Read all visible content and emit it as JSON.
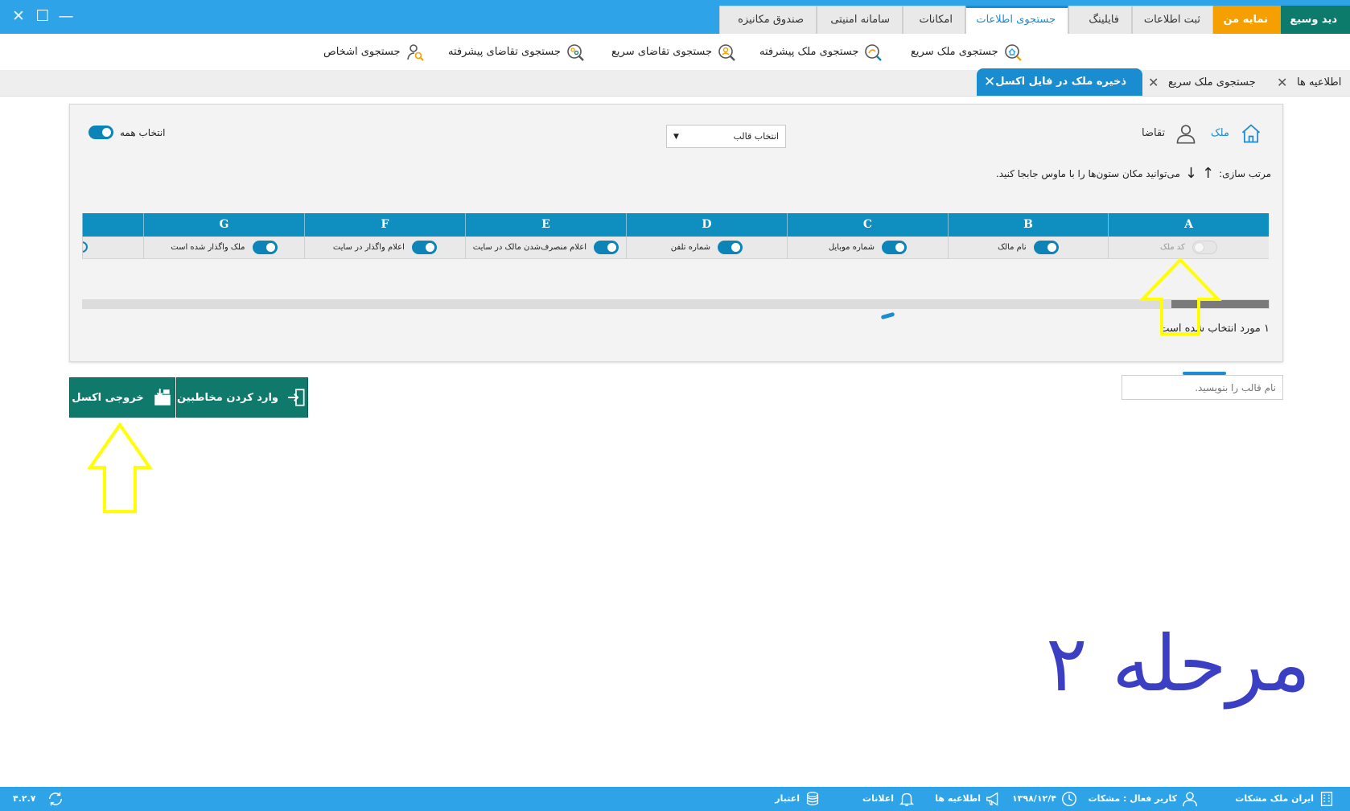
{
  "window": {
    "close": "✕",
    "maximize": "☐",
    "minimize": "—"
  },
  "main_tabs": [
    {
      "label": "دید وسیع"
    },
    {
      "label": "نمایه من"
    },
    {
      "label": "ثبت اطلاعات"
    },
    {
      "label": "فایلینگ"
    },
    {
      "label": "جستجوی اطلاعات"
    },
    {
      "label": "امکانات"
    },
    {
      "label": "سامانه امنیتی"
    },
    {
      "label": "صندوق مکانیزه"
    }
  ],
  "sub_toolbar": [
    {
      "label": "جستجوی ملک سریع",
      "icon": "home-search-icon"
    },
    {
      "label": "جستجوی ملک پیشرفته",
      "icon": "advanced-search-icon"
    },
    {
      "label": "جستجوی تقاضای سریع",
      "icon": "person-search-icon"
    },
    {
      "label": "جستجوی تقاضای پیشرفته",
      "icon": "advanced-person-search-icon"
    },
    {
      "label": "جستجوی اشخاص",
      "icon": "people-search-icon"
    }
  ],
  "doc_tabs": [
    {
      "label": "اطلاعیه ها"
    },
    {
      "label": "جستجوی ملک سریع"
    },
    {
      "label": "ذخیره ملک در فایل اکسل"
    }
  ],
  "panel": {
    "type_property": "ملک",
    "type_demand": "تقاضا",
    "template_select": "انتخاب قالب",
    "select_all": "انتخاب همه",
    "sort_label": "مرتب سازی:",
    "sort_hint": "می‌توانید مکان ستون‌ها را با ماوس جابجا کنید.",
    "columns": [
      {
        "letter": "A",
        "label": "کد ملک",
        "on": false
      },
      {
        "letter": "B",
        "label": "نام مالک",
        "on": true
      },
      {
        "letter": "C",
        "label": "شماره موبایل",
        "on": true
      },
      {
        "letter": "D",
        "label": "شماره تلفن",
        "on": true
      },
      {
        "letter": "E",
        "label": "اعلام منصرف‌شدن مالک در سایت",
        "on": true
      },
      {
        "letter": "F",
        "label": "اعلام واگذار در سایت",
        "on": true
      },
      {
        "letter": "G",
        "label": "ملک واگذار شده است",
        "on": true
      }
    ],
    "selected_count": "۱ مورد انتخاب شده است"
  },
  "template_name_placeholder": "نام قالب را بنویسید.",
  "buttons": {
    "import_contacts": "وارد کردن مخاطبین",
    "export_excel": "خروجی اکسل"
  },
  "annotation": "مرحله ۲",
  "status_bar": {
    "company": "ایران ملک مشکات",
    "active_user": "کاربر فعال : مشکات",
    "date": "۱۳۹۸/۱۲/۴",
    "announcements": "اطلاعیه ها",
    "notifications": "اعلانات",
    "credit": "اعتبار",
    "version": "۴.۲.۷"
  },
  "colors": {
    "titlebar": "#2ea3e8",
    "accent_blue": "#1c8cd2",
    "column_header": "#0e8fbf",
    "button_green": "#0f7a6c",
    "highlight_orange": "#f5a000",
    "annotation_arrow": "#ffff00",
    "annotation_text": "#3b3fc4"
  }
}
